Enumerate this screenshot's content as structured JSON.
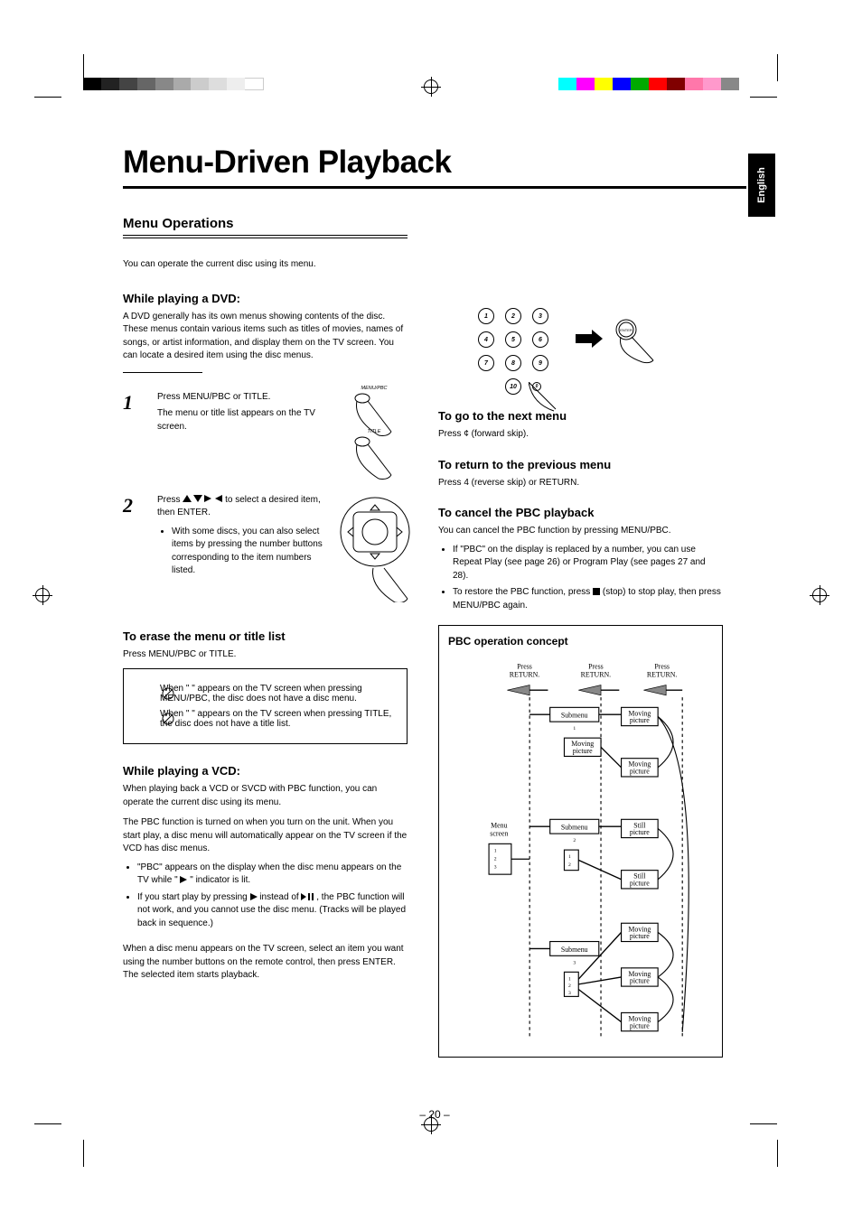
{
  "lang_tab": "English",
  "page_title": "Menu-Driven Playback",
  "section_title": "Menu Operations",
  "intro": "You can operate the current disc using its menu.",
  "dvd": {
    "heading": "While playing a DVD:",
    "p1": "A DVD generally has its own menus showing contents of the disc. These menus contain various items such as titles of movies, names of songs, or artist information, and display them on the TV screen. You can locate a desired item using the disc menus.",
    "step1": {
      "num": "1",
      "text": "Press MENU/PBC or TITLE.",
      "sub": "The menu or title list appears on the TV screen.",
      "labels": {
        "menu": "MENU/PBC",
        "title": "TITLE"
      }
    },
    "step2": {
      "num": "2",
      "pre": "Press ",
      "post": " to select a desired item, then ENTER.",
      "bullet": "With some discs, you can also select items by pressing the number buttons corresponding to the item numbers listed."
    },
    "erase": {
      "heading": "To erase the menu or title list",
      "line": "Press MENU/PBC or TITLE.",
      "box1": "When \"     \" appears on the TV screen when pressing MENU/PBC, the disc does not have a disc menu.",
      "box2": "When \"     \" appears on the TV screen when pressing TITLE, the disc does not have a title list."
    }
  },
  "vcd": {
    "heading": "While playing a VCD:",
    "p1": "When playing back a VCD or SVCD with PBC function, you can operate the current disc using its menu.",
    "p2": "The PBC function is turned on when you turn on the unit. When you start play, a disc menu will automatically appear on the TV screen if the VCD has disc menus.",
    "b1_pre": "\"PBC\" appears on the display when the disc menu appears on the TV while \"",
    "b1_mid": "\" indicator is lit.",
    "b2_pre": "If you start play by pressing ",
    "b2_mid": " instead of ",
    "b2_post": ", the PBC function will not work, and you cannot use the disc menu. (Tracks will be played back in sequence.)",
    "p3": "When a disc menu appears on the TV screen, select an item you want using the number buttons on  the remote control, then press ENTER. The selected item starts playback."
  },
  "right": {
    "numpad": [
      "1",
      "2",
      "3",
      "4",
      "5",
      "6",
      "7",
      "8",
      "9",
      "10",
      "0"
    ],
    "enter": "ENTER",
    "next": {
      "heading": "To go to the next menu",
      "line": "Press ¢ (forward skip)."
    },
    "prev": {
      "heading": "To return to the previous menu",
      "line": "Press 4 (reverse skip) or RETURN."
    },
    "cancel": {
      "heading": "To cancel the PBC playback",
      "p": "You can cancel the PBC function by pressing MENU/PBC.",
      "b1_pre": "If \"PBC\" on the display is replaced by a number, you can use Repeat Play (see page 26) or Program Play (see pages 27 and 28).",
      "b2_pre": "To restore the PBC function, press ",
      "b2_post": " (stop) to stop play, then press MENU/PBC again."
    }
  },
  "pbc": {
    "heading": "PBC operation concept",
    "return": "Press\nRETURN.",
    "menu_screen": "Menu\nscreen",
    "submenu": "Submenu",
    "moving": "Moving\npicture",
    "still": "Still\npicture"
  },
  "page_num": "– 20 –"
}
